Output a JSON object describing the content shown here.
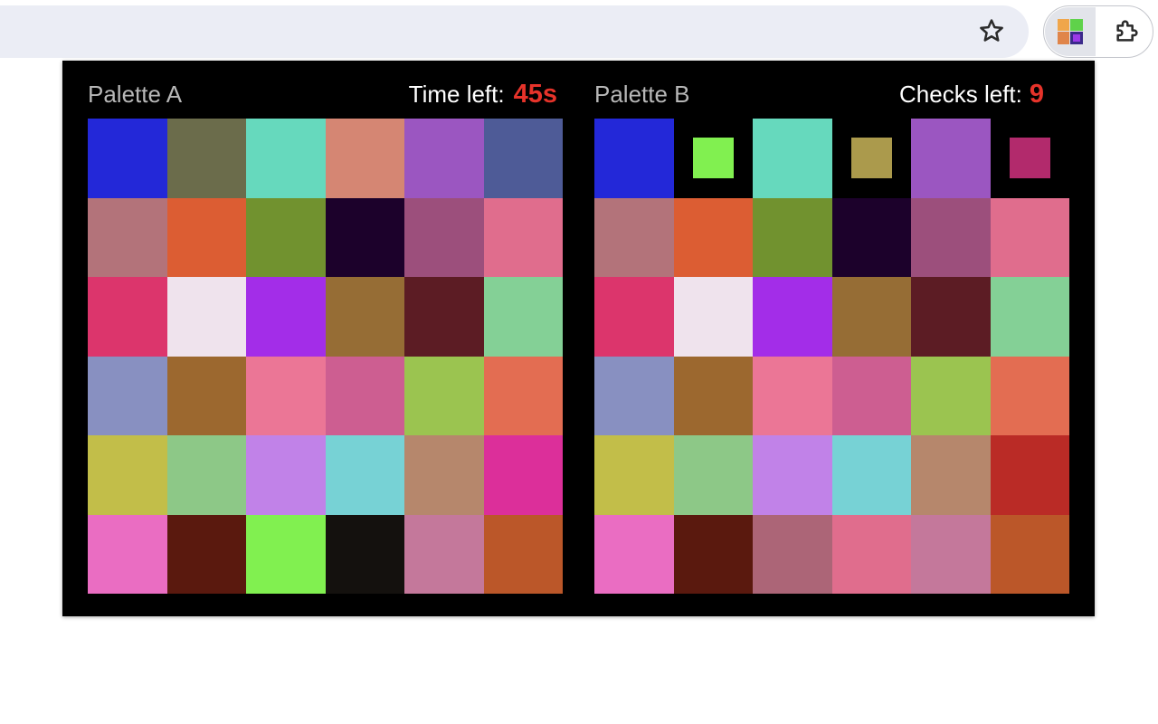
{
  "toolbar": {
    "star_icon": "star-outline-icon",
    "extension_icon": "color-palette-extension-icon",
    "puzzle_icon": "puzzle-piece-icon",
    "colors": {
      "omnibox_bg": "#ebedf5",
      "active_ext_bg": "#e2e4ea"
    }
  },
  "palette_a": {
    "title": "Palette A",
    "stat_label": "Time left:",
    "stat_value": "45s",
    "rows": [
      [
        {
          "color": "#2328d8"
        },
        {
          "color": "#6b6c4b"
        },
        {
          "color": "#66d9bd"
        },
        {
          "color": "#d58673"
        },
        {
          "color": "#9b56c1"
        },
        {
          "color": "#4e5b97"
        }
      ],
      [
        {
          "color": "#b3737a"
        },
        {
          "color": "#dc5d33"
        },
        {
          "color": "#71922f"
        },
        {
          "color": "#1c012b"
        },
        {
          "color": "#9c4f7c"
        },
        {
          "color": "#e06d8d"
        }
      ],
      [
        {
          "color": "#dc356c"
        },
        {
          "color": "#efe3ed"
        },
        {
          "color": "#a32de8"
        },
        {
          "color": "#966d35"
        },
        {
          "color": "#5c1c24"
        },
        {
          "color": "#84d096"
        }
      ],
      [
        {
          "color": "#8890c1"
        },
        {
          "color": "#9c682f"
        },
        {
          "color": "#eb7696"
        },
        {
          "color": "#cd5e91"
        },
        {
          "color": "#9bc450"
        },
        {
          "color": "#e36d52"
        }
      ],
      [
        {
          "color": "#c2be49"
        },
        {
          "color": "#8dc887"
        },
        {
          "color": "#c182e8"
        },
        {
          "color": "#77d2d5"
        },
        {
          "color": "#b6876c"
        },
        {
          "color": "#dc2f9a"
        }
      ],
      [
        {
          "color": "#ea6dc2"
        },
        {
          "color": "#5a190e"
        },
        {
          "color": "#81f050"
        },
        {
          "color": "#14110e"
        },
        {
          "color": "#c4789b"
        },
        {
          "color": "#bb5729"
        }
      ]
    ]
  },
  "palette_b": {
    "title": "Palette B",
    "stat_label": "Checks left:",
    "stat_value": "9",
    "rows": [
      [
        {
          "color": "#2328d8"
        },
        {
          "color": "#81f050",
          "small": true
        },
        {
          "color": "#66d9bd"
        },
        {
          "color": "#ab9a4c",
          "small": true
        },
        {
          "color": "#9b56c1"
        },
        {
          "color": "#b22a6c",
          "small": true
        }
      ],
      [
        {
          "color": "#b3737a"
        },
        {
          "color": "#dc5d33"
        },
        {
          "color": "#71922f"
        },
        {
          "color": "#1c012b"
        },
        {
          "color": "#9c4f7c"
        },
        {
          "color": "#e06d8d"
        }
      ],
      [
        {
          "color": "#dc356c"
        },
        {
          "color": "#efe3ed"
        },
        {
          "color": "#a32de8"
        },
        {
          "color": "#966d35"
        },
        {
          "color": "#5c1c24"
        },
        {
          "color": "#84d096"
        }
      ],
      [
        {
          "color": "#8890c1"
        },
        {
          "color": "#9c682f"
        },
        {
          "color": "#eb7696"
        },
        {
          "color": "#cd5e91"
        },
        {
          "color": "#9bc450"
        },
        {
          "color": "#e36d52"
        }
      ],
      [
        {
          "color": "#c2be49"
        },
        {
          "color": "#8dc887"
        },
        {
          "color": "#c182e8"
        },
        {
          "color": "#77d2d5"
        },
        {
          "color": "#b6876c"
        },
        {
          "color": "#ba2b26"
        }
      ],
      [
        {
          "color": "#ea6dc2"
        },
        {
          "color": "#5a190e"
        },
        {
          "color": "#ac6577"
        },
        {
          "color": "#e06d8d"
        },
        {
          "color": "#c4789b"
        },
        {
          "color": "#bb5729"
        }
      ]
    ]
  }
}
